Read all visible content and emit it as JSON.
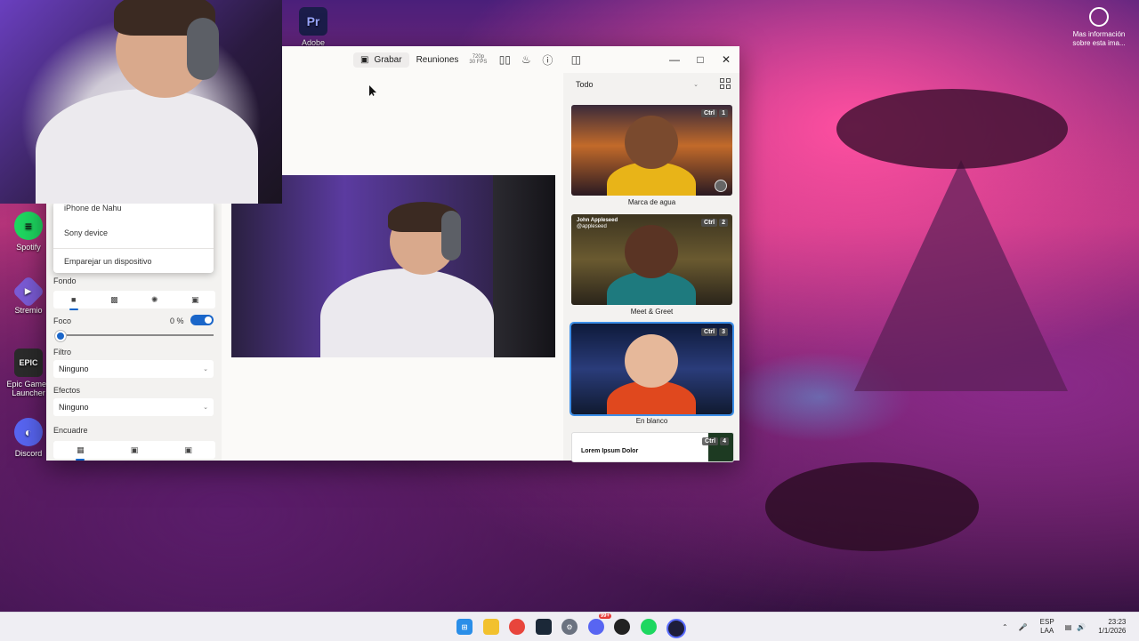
{
  "desktop": {
    "icons": [
      {
        "label": "Adobe Premiere",
        "glyph": "Pr",
        "color": "#1b1d4a"
      },
      {
        "label": "Spotify",
        "glyph": "≡",
        "color": "#1ed760"
      },
      {
        "label": "Stremio",
        "glyph": "▶",
        "color": "#7b5bd6"
      },
      {
        "label": "Epic Games Launcher",
        "glyph": "EPIC",
        "color": "#2b2b2b"
      },
      {
        "label": "Discord",
        "glyph": "◐",
        "color": "#5865f2"
      }
    ],
    "info_label": "Mas información sobre esta ima..."
  },
  "app": {
    "toolbar": {
      "record_label": "Grabar",
      "meetings_label": "Reuniones",
      "resolution": "720p",
      "fps": "30 FPS"
    },
    "devices": {
      "items": [
        "iPhone de Nahu",
        "Sony device"
      ],
      "pair_label": "Emparejar un dispositivo"
    },
    "background": {
      "label": "Fondo"
    },
    "focus": {
      "label": "Foco",
      "value": "0 %",
      "enabled": true,
      "level": 0
    },
    "filter": {
      "label": "Filtro",
      "value": "Ninguno"
    },
    "effects": {
      "label": "Efectos",
      "value": "Ninguno"
    },
    "framing": {
      "label": "Encuadre"
    },
    "scenes": {
      "filter_value": "Todo",
      "items": [
        {
          "name": "Marca de agua",
          "shortcut": "Ctrl",
          "key": "1"
        },
        {
          "name": "Meet & Greet",
          "shortcut": "Ctrl",
          "key": "2",
          "tag_name": "John Appleseed",
          "tag_handle": "@appleseed"
        },
        {
          "name": "En blanco",
          "shortcut": "Ctrl",
          "key": "3"
        },
        {
          "name": "",
          "shortcut": "Ctrl",
          "key": "4",
          "slide_title": "Lorem Ipsum Dolor"
        }
      ]
    }
  },
  "taskbar": {
    "language": "ESP",
    "layout": "LAA",
    "time": "23:23",
    "date": "1/1/2026",
    "badge": "99+"
  }
}
